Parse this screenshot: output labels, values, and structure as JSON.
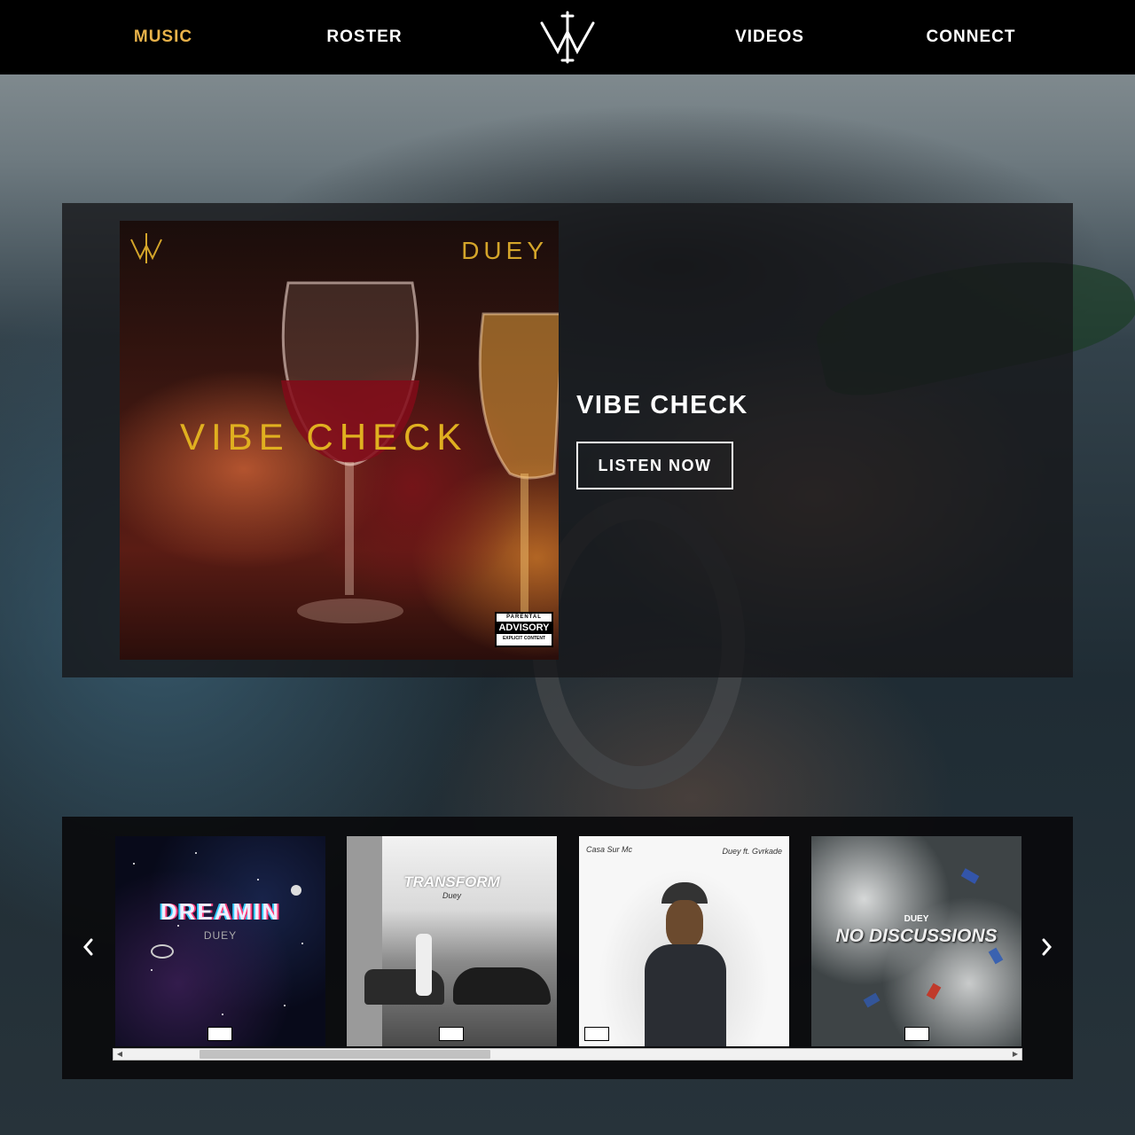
{
  "nav": {
    "items": [
      {
        "label": "MUSIC",
        "active": true
      },
      {
        "label": "ROSTER",
        "active": false
      },
      {
        "label": "VIDEOS",
        "active": false
      },
      {
        "label": "CONNECT",
        "active": false
      }
    ],
    "logo_icon": "vv-monogram-logo-icon",
    "active_color": "#e8b24a"
  },
  "featured": {
    "cover": {
      "artist": "DUEY",
      "title": "VIBE CHECK",
      "advisory": {
        "line1": "PARENTAL",
        "line2": "ADVISORY",
        "line3": "EXPLICIT CONTENT"
      }
    },
    "title": "VIBE CHECK",
    "button_label": "LISTEN NOW"
  },
  "carousel": {
    "prev_icon": "chevron-left-icon",
    "next_icon": "chevron-right-icon",
    "albums": [
      {
        "title": "DREAMIN",
        "artist": "DUEY"
      },
      {
        "title": "TRANSFORM",
        "artist": "Duey"
      },
      {
        "title": "Casa Sur Mc",
        "artist": "Duey ft. Gvrkade"
      },
      {
        "title": "NO DISCUSSIONS",
        "artist": "DUEY"
      }
    ]
  }
}
